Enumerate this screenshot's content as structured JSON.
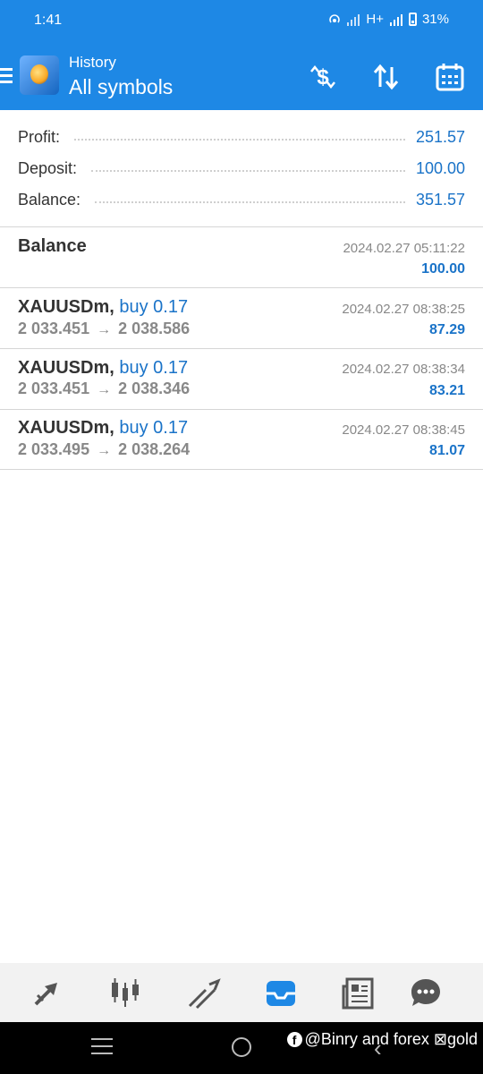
{
  "status": {
    "time": "1:41",
    "network": "H+",
    "battery": "31%"
  },
  "toolbar": {
    "subtitle": "History",
    "title": "All symbols"
  },
  "summary": [
    {
      "label": "Profit:",
      "value": "251.57"
    },
    {
      "label": "Deposit:",
      "value": "100.00"
    },
    {
      "label": "Balance:",
      "value": "351.57"
    }
  ],
  "balance_entry": {
    "title": "Balance",
    "date": "2024.02.27 05:11:22",
    "amount": "100.00"
  },
  "deals": [
    {
      "symbol": "XAUUSDm,",
      "type": "buy 0.17",
      "open": "2 033.451",
      "arrow": "→",
      "close": "2 038.586",
      "date": "2024.02.27 08:38:25",
      "profit": "87.29"
    },
    {
      "symbol": "XAUUSDm,",
      "type": "buy 0.17",
      "open": "2 033.451",
      "arrow": "→",
      "close": "2 038.346",
      "date": "2024.02.27 08:38:34",
      "profit": "83.21"
    },
    {
      "symbol": "XAUUSDm,",
      "type": "buy 0.17",
      "open": "2 033.495",
      "arrow": "→",
      "close": "2 038.264",
      "date": "2024.02.27 08:38:45",
      "profit": "81.07"
    }
  ],
  "bottom_nav": [
    "quotes-icon",
    "chart-icon",
    "trade-icon",
    "history-icon",
    "news-icon",
    "chat-icon"
  ],
  "watermark": "@Binry and forex ⊠gold",
  "colors": {
    "accent": "#1e88e5",
    "value_blue": "#1a73c8",
    "active_tab": "#1e88e5"
  }
}
